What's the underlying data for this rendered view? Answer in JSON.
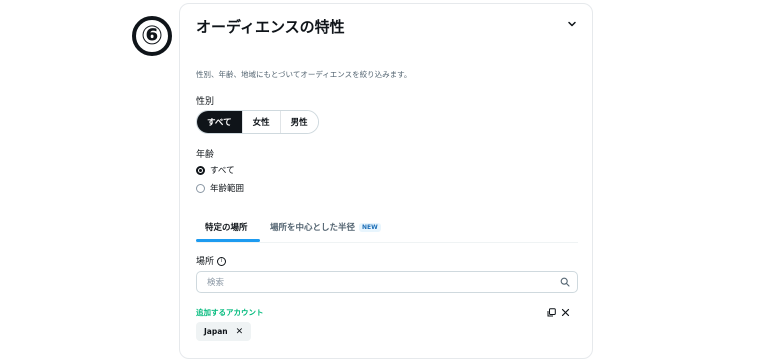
{
  "step_marker": "⑥",
  "section": {
    "title": "オーディエンスの特性",
    "description": "性別、年齢、地域にもとづいてオーディエンスを絞り込みます。"
  },
  "gender": {
    "label": "性別",
    "options": [
      "すべて",
      "女性",
      "男性"
    ],
    "selected": "すべて"
  },
  "age": {
    "label": "年齢",
    "options": [
      "すべて",
      "年齢範囲"
    ],
    "selected": "すべて"
  },
  "location_tabs": {
    "tabs": [
      "特定の場所",
      "場所を中心とした半径"
    ],
    "active": "特定の場所",
    "new_badge": "NEW"
  },
  "location": {
    "label": "場所",
    "info_icon": "ⓘ",
    "search_placeholder": "検索",
    "added_label": "追加するアカウント",
    "chips": [
      "Japan"
    ]
  },
  "colors": {
    "accent_blue": "#1d9bf0",
    "added_green": "#00ba7c",
    "text_primary": "#0f1419"
  }
}
